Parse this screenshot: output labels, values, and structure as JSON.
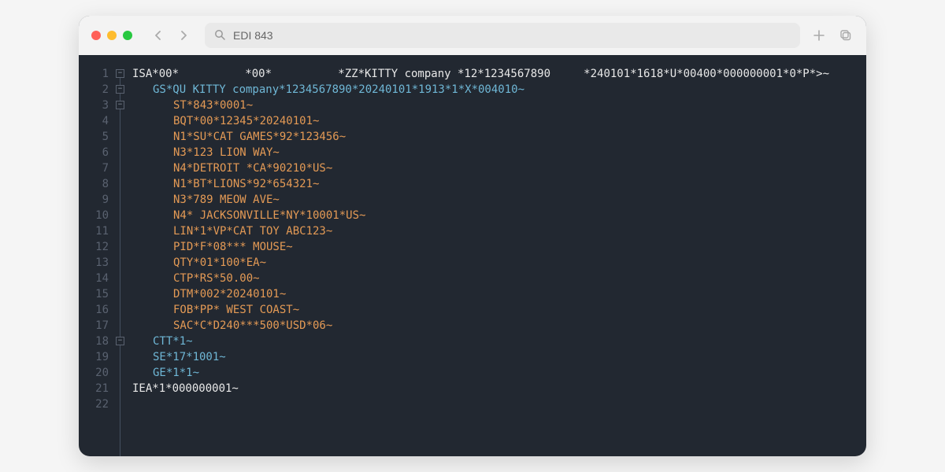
{
  "search": {
    "value": "EDI 843",
    "placeholder": ""
  },
  "lines": [
    {
      "n": 1,
      "indent": 1,
      "color": "white",
      "text": "ISA*00*          *00*          *ZZ*KITTY company *12*1234567890     *240101*1618*U*00400*000000001*0*P*>~"
    },
    {
      "n": 2,
      "indent": 2,
      "color": "blue",
      "text": "GS*QU KITTY company*1234567890*20240101*1913*1*X*004010~"
    },
    {
      "n": 3,
      "indent": 3,
      "color": "orange",
      "text": "ST*843*0001~"
    },
    {
      "n": 4,
      "indent": 3,
      "color": "orange",
      "text": "BQT*00*12345*20240101~"
    },
    {
      "n": 5,
      "indent": 3,
      "color": "orange",
      "text": "N1*SU*CAT GAMES*92*123456~"
    },
    {
      "n": 6,
      "indent": 3,
      "color": "orange",
      "text": "N3*123 LION WAY~"
    },
    {
      "n": 7,
      "indent": 3,
      "color": "orange",
      "text": "N4*DETROIT *CA*90210*US~"
    },
    {
      "n": 8,
      "indent": 3,
      "color": "orange",
      "text": "N1*BT*LIONS*92*654321~"
    },
    {
      "n": 9,
      "indent": 3,
      "color": "orange",
      "text": "N3*789 MEOW AVE~"
    },
    {
      "n": 10,
      "indent": 3,
      "color": "orange",
      "text": "N4* JACKSONVILLE*NY*10001*US~"
    },
    {
      "n": 11,
      "indent": 3,
      "color": "orange",
      "text": "LIN*1*VP*CAT TOY ABC123~"
    },
    {
      "n": 12,
      "indent": 3,
      "color": "orange",
      "text": "PID*F*08*** MOUSE~"
    },
    {
      "n": 13,
      "indent": 3,
      "color": "orange",
      "text": "QTY*01*100*EA~"
    },
    {
      "n": 14,
      "indent": 3,
      "color": "orange",
      "text": "CTP*RS*50.00~"
    },
    {
      "n": 15,
      "indent": 3,
      "color": "orange",
      "text": "DTM*002*20240101~"
    },
    {
      "n": 16,
      "indent": 3,
      "color": "orange",
      "text": "FOB*PP* WEST COAST~"
    },
    {
      "n": 17,
      "indent": 3,
      "color": "orange",
      "text": "SAC*C*D240***500*USD*06~"
    },
    {
      "n": 18,
      "indent": 2,
      "color": "blue",
      "text": "CTT*1~"
    },
    {
      "n": 19,
      "indent": 2,
      "color": "blue",
      "text": "SE*17*1001~"
    },
    {
      "n": 20,
      "indent": 2,
      "color": "blue",
      "text": "GE*1*1~"
    },
    {
      "n": 21,
      "indent": 1,
      "color": "white",
      "text": "IEA*1*000000001~"
    },
    {
      "n": 22,
      "indent": 1,
      "color": "white",
      "text": ""
    }
  ],
  "fold_markers_at": [
    1,
    2,
    3,
    18
  ]
}
